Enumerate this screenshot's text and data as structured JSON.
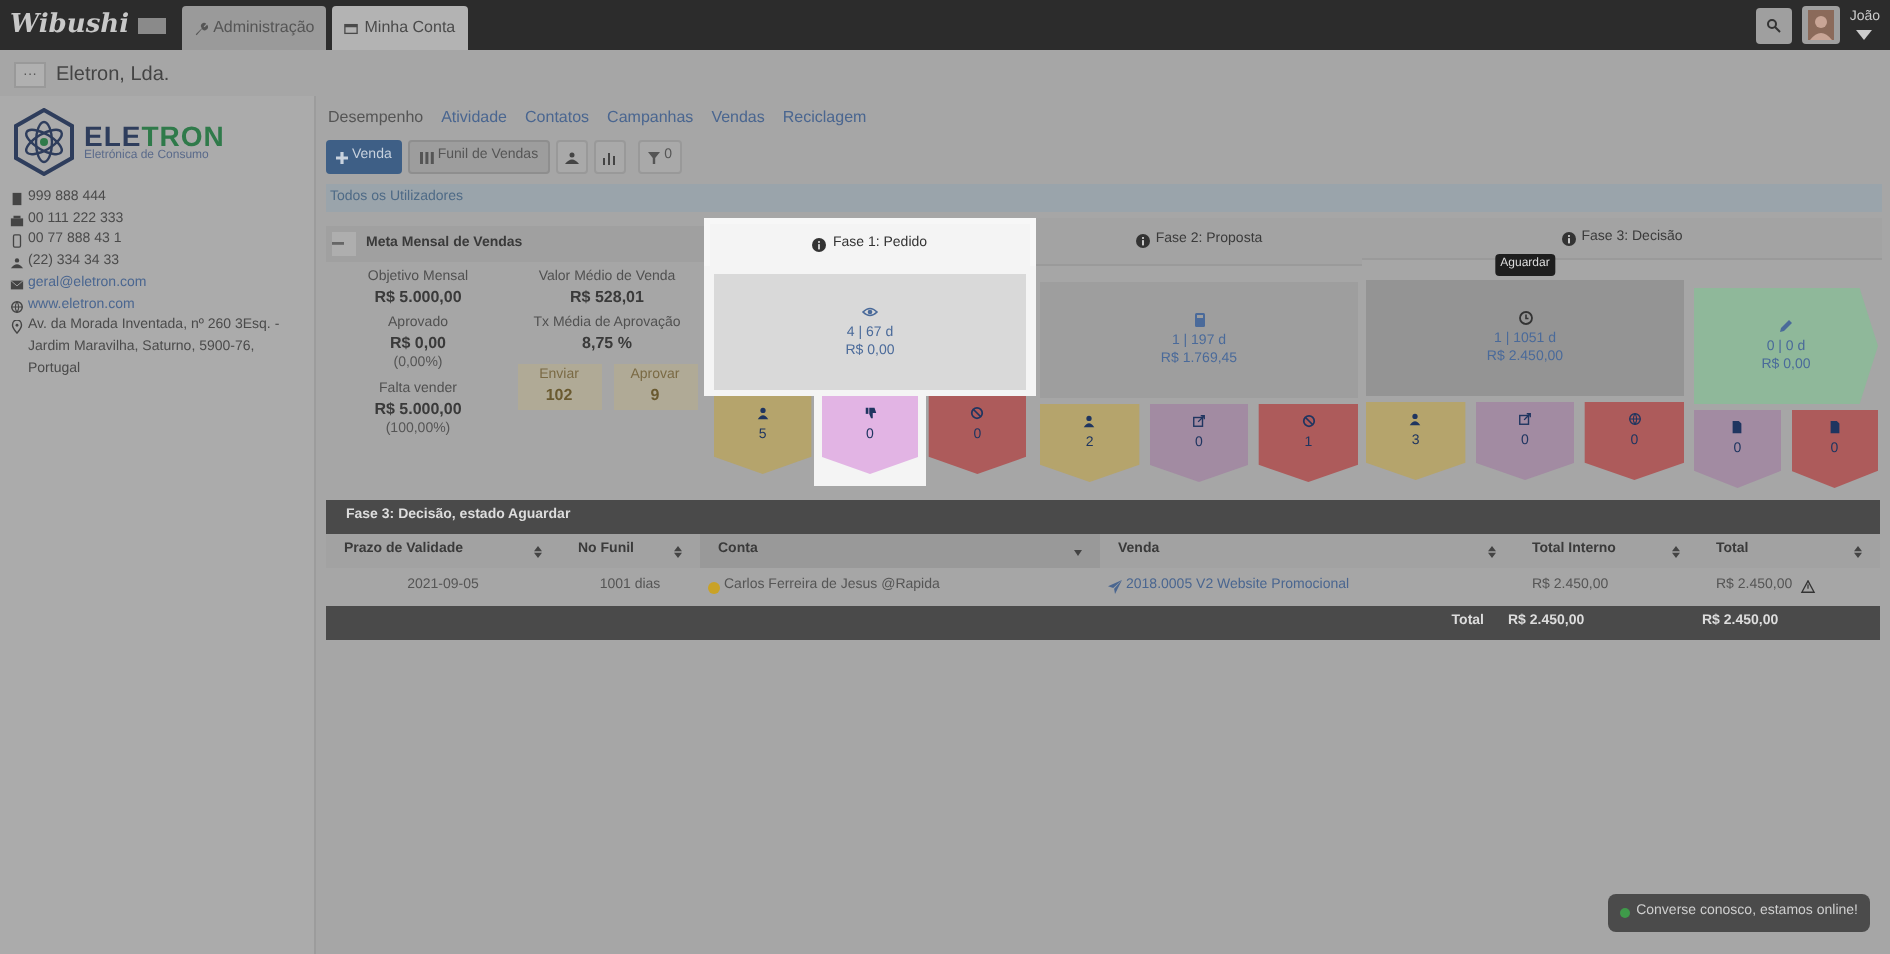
{
  "topbar": {
    "logo": "Wibushi",
    "tabs": [
      {
        "label": "Administração",
        "selected": false,
        "kind": "wrench"
      },
      {
        "label": "Minha Conta",
        "selected": true,
        "kind": "card"
      }
    ],
    "user": "João"
  },
  "entity": {
    "menu": "···",
    "name": "Eletron, Lda."
  },
  "company": {
    "logo_name_a": "ELE",
    "logo_name_b": "TRON",
    "logo_tagline": "Eletrónica de Consumo",
    "contacts": [
      {
        "kind": "phone",
        "text": "999 888 444",
        "link": false
      },
      {
        "kind": "fax",
        "text": "00 111 222 333",
        "link": false
      },
      {
        "kind": "mobile",
        "text": "00 77 888 43 1",
        "link": false
      },
      {
        "kind": "office",
        "text": "(22) 334 34 33",
        "link": false
      },
      {
        "kind": "email",
        "text": "geral@eletron.com",
        "link": true
      },
      {
        "kind": "web",
        "text": "www.eletron.com",
        "link": true
      },
      {
        "kind": "address",
        "text": "Av. da Morada Inventada, nº 260 3Esq. - Jardim Maravilha, Saturno, 5900-76, Portugal",
        "link": false
      }
    ]
  },
  "nav": [
    {
      "label": "Desempenho",
      "selected": true
    },
    {
      "label": "Atividade",
      "selected": false
    },
    {
      "label": "Contatos",
      "selected": false
    },
    {
      "label": "Campanhas",
      "selected": false
    },
    {
      "label": "Vendas",
      "selected": false
    },
    {
      "label": "Reciclagem",
      "selected": false
    }
  ],
  "toolbar": {
    "new_button": "Venda",
    "funnel_button": "Funil de Vendas",
    "filter_count": "0"
  },
  "user_filter": "Todos os Utilizadores",
  "goal": {
    "title": "Meta Mensal de Vendas",
    "left": [
      {
        "label": "Objetivo Mensal",
        "value": "R$ 5.000,00"
      },
      {
        "label": "Aprovado",
        "value": "R$ 0,00",
        "note": "(0,00%)"
      },
      {
        "label": "Falta vender",
        "value": "R$ 5.000,00",
        "note": "(100,00%)"
      }
    ],
    "right": [
      {
        "label": "Valor Médio de Venda",
        "value": "R$ 528,01"
      },
      {
        "label": "Tx Média de Aprovação",
        "value": "8,75 %"
      }
    ],
    "counters": [
      {
        "label": "Enviar",
        "value": "102"
      },
      {
        "label": "Aprovar",
        "value": "9"
      }
    ]
  },
  "funnel": {
    "phases": [
      {
        "title": "Fase 1: Pedido",
        "highlighted": true,
        "stages": [
          {
            "kind": "watch",
            "color": "#d9d9d9",
            "line1": "4 | 67 d",
            "line2": "R$ 0,00",
            "tiles": [
              {
                "kind": "person",
                "color": "#b5a46c",
                "count": "5",
                "highlighted": false
              },
              {
                "kind": "thumbs-down",
                "color": "#e2b4e4",
                "count": "0",
                "highlighted": true
              },
              {
                "kind": "ban",
                "color": "#ad5b5b",
                "count": "0",
                "highlighted": false
              }
            ]
          }
        ]
      },
      {
        "title": "Fase 2: Proposta",
        "highlighted": false,
        "stages": [
          {
            "kind": "quote",
            "color": "#9e9e9e",
            "line1": "1 | 197 d",
            "line2": "R$ 1.769,45",
            "tiles": [
              {
                "kind": "person",
                "color": "#b5a46c",
                "count": "2",
                "highlighted": false
              },
              {
                "kind": "link",
                "color": "#a28ba2",
                "count": "0",
                "highlighted": false
              },
              {
                "kind": "ban",
                "color": "#ad5b5b",
                "count": "1",
                "highlighted": false
              }
            ]
          }
        ]
      },
      {
        "title": "Fase 3: Decisão",
        "highlighted": false,
        "stages": [
          {
            "kind": "wait",
            "color": "#949494",
            "line1": "1 | 1051 d",
            "line2": "R$ 2.450,00",
            "tooltip": "Aguardar",
            "tiles": [
              {
                "kind": "person",
                "color": "#b5a46c",
                "count": "3",
                "highlighted": false
              },
              {
                "kind": "link",
                "color": "#a28ba2",
                "count": "0",
                "highlighted": false
              },
              {
                "kind": "globe",
                "color": "#ad5b5b",
                "count": "0",
                "highlighted": false
              }
            ]
          },
          {
            "kind": "draft",
            "color": "#8fb89a",
            "line1": "0 | 0 d",
            "line2": "R$ 0,00",
            "tiles": [
              {
                "kind": "document",
                "color": "#a28ba2",
                "count": "0",
                "highlighted": false
              },
              {
                "kind": "document",
                "color": "#ad5b5b",
                "count": "0",
                "highlighted": false
              }
            ]
          }
        ]
      }
    ]
  },
  "table": {
    "title": "Fase 3: Decisão, estado Aguardar",
    "columns": [
      {
        "label": "Prazo de Validade",
        "sorted": false
      },
      {
        "label": "No Funil",
        "sorted": false
      },
      {
        "label": "Conta",
        "sorted": true
      },
      {
        "label": "Venda",
        "sorted": false
      },
      {
        "label": "Total Interno",
        "sorted": false
      },
      {
        "label": "Total",
        "sorted": false
      }
    ],
    "rows": [
      {
        "due": "2021-09-05",
        "in_funnel": "1001 dias",
        "account": {
          "name": "Carlos Ferreira de Jesus @Rapida",
          "color": "#c9a227"
        },
        "sale": "2018.0005 V2 Website Promocional",
        "total_internal": "R$ 2.450,00",
        "total": "R$ 2.450,00",
        "warning": true
      }
    ],
    "footer": {
      "label": "Total",
      "total_internal": "R$ 2.450,00",
      "total": "R$ 2.450,00"
    }
  },
  "chat": {
    "text": "Converse conosco, estamos online!",
    "online": true
  }
}
